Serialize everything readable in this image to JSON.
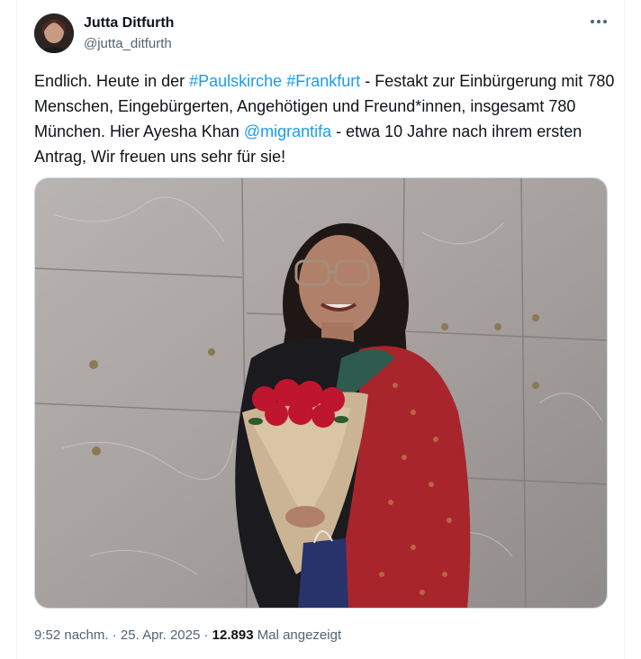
{
  "author": {
    "name": "Jutta Ditfurth",
    "handle": "@jutta_ditfurth",
    "avatar_icon": "profile-photo"
  },
  "more_icon": "more-horizontal-icon",
  "tweet": {
    "t1": "Endlich. Heute in der ",
    "hashtag1": "#Paulskirche",
    "t2": " ",
    "hashtag2": "#Frankfurt",
    "t3": " - Festakt zur Einbürgerung mit 780 Menschen, Eingebürgerten, Angehötigen und Freund*innen, insgesamt 780 München. Hier Ayesha Khan ",
    "mention": "@migrantifa",
    "t4": " - etwa 10 Jahre nach ihrem ersten Antrag, Wir freuen uns sehr für sie!"
  },
  "meta": {
    "time": "9:52 nachm.",
    "sep1": " · ",
    "date": "25. Apr. 2025",
    "sep2": " · ",
    "views": "12.893",
    "views_label": " Mal angezeigt"
  },
  "colors": {
    "link": "#1d9bf0",
    "text": "#0f1419",
    "muted": "#536471",
    "border": "#eff3f4"
  }
}
